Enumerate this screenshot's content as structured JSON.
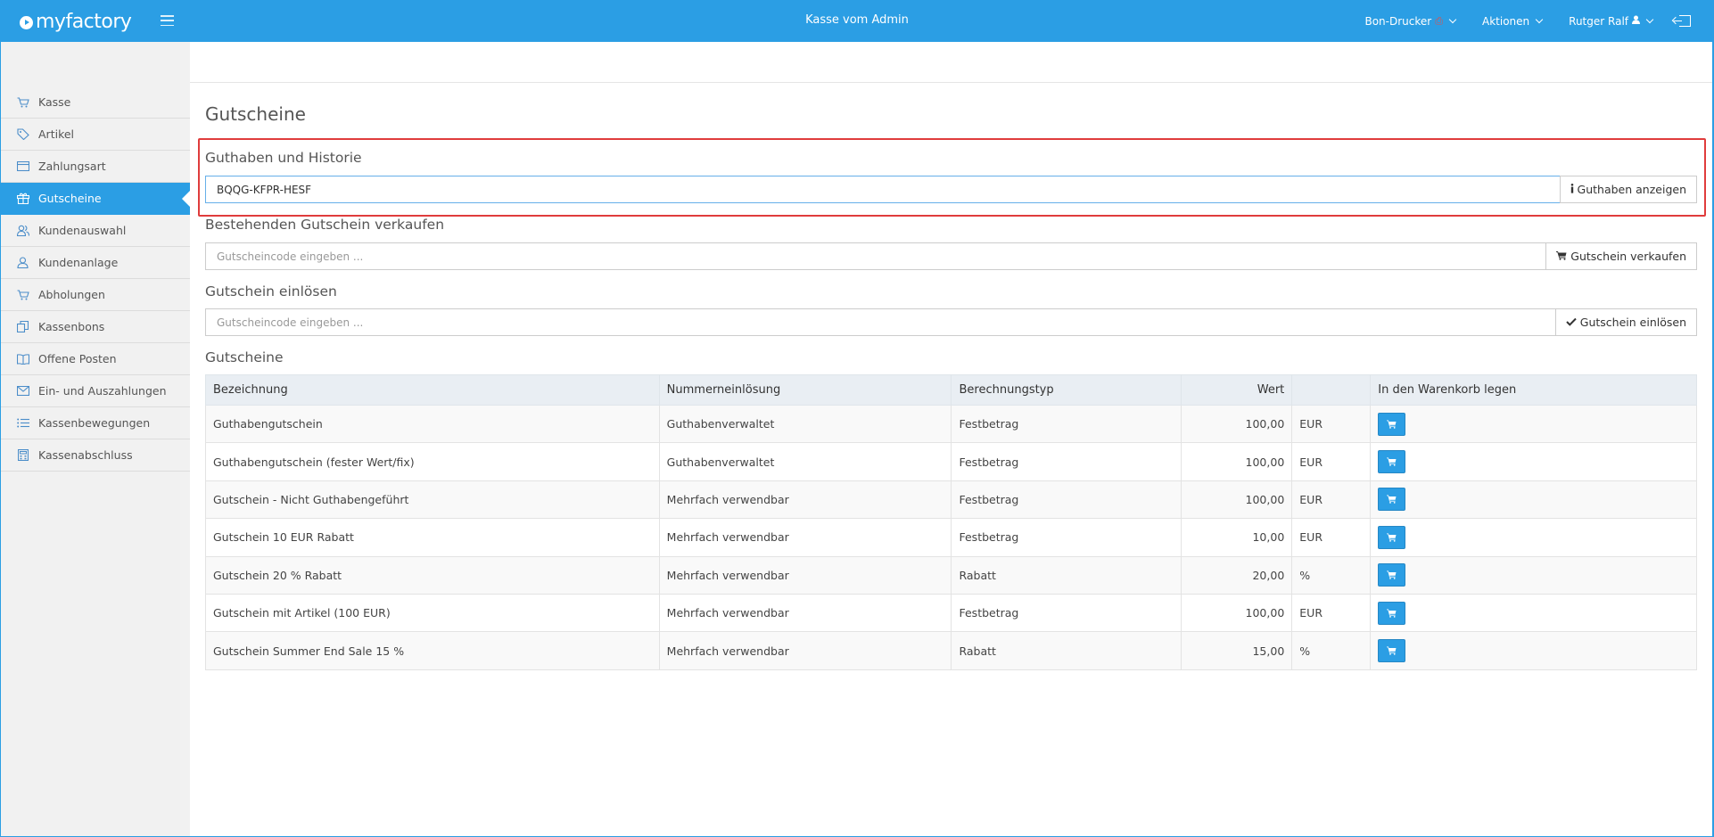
{
  "header": {
    "logo_text": "myfactory",
    "title": "Kasse vom Admin",
    "menus": [
      {
        "label": "Bon-Drucker"
      },
      {
        "label": "Aktionen"
      },
      {
        "label": "Rutger Ralf"
      }
    ]
  },
  "sidebar": {
    "items": [
      {
        "label": "Kasse",
        "icon": "cart-icon"
      },
      {
        "label": "Artikel",
        "icon": "tag-icon"
      },
      {
        "label": "Zahlungsart",
        "icon": "card-icon"
      },
      {
        "label": "Gutscheine",
        "icon": "gift-icon",
        "active": true
      },
      {
        "label": "Kundenauswahl",
        "icon": "users-icon"
      },
      {
        "label": "Kundenanlage",
        "icon": "user-icon"
      },
      {
        "label": "Abholungen",
        "icon": "cart-icon"
      },
      {
        "label": "Kassenbons",
        "icon": "copy-icon"
      },
      {
        "label": "Offene Posten",
        "icon": "book-icon"
      },
      {
        "label": "Ein- und Auszahlungen",
        "icon": "envelope-icon"
      },
      {
        "label": "Kassenbewegungen",
        "icon": "list-icon"
      },
      {
        "label": "Kassenabschluss",
        "icon": "calculator-icon"
      }
    ]
  },
  "main": {
    "page_title": "Gutscheine",
    "balance": {
      "title": "Guthaben und Historie",
      "input_value": "BQQG-KFPR-HESF",
      "button_label": "Guthaben anzeigen"
    },
    "sell": {
      "title": "Bestehenden Gutschein verkaufen",
      "placeholder": "Gutscheincode eingeben ...",
      "button_label": "Gutschein verkaufen"
    },
    "redeem": {
      "title": "Gutschein einlösen",
      "placeholder": "Gutscheincode eingeben ...",
      "button_label": "Gutschein einlösen"
    },
    "table": {
      "title": "Gutscheine",
      "columns": [
        "Bezeichnung",
        "Nummerneinlösung",
        "Berechnungstyp",
        "Wert",
        "",
        "In den Warenkorb legen"
      ],
      "rows": [
        {
          "name": "Guthabengutschein",
          "numbering": "Guthabenverwaltet",
          "calc": "Festbetrag",
          "value": "100,00",
          "unit": "EUR"
        },
        {
          "name": "Guthabengutschein (fester Wert/fix)",
          "numbering": "Guthabenverwaltet",
          "calc": "Festbetrag",
          "value": "100,00",
          "unit": "EUR"
        },
        {
          "name": "Gutschein - Nicht Guthabengeführt",
          "numbering": "Mehrfach verwendbar",
          "calc": "Festbetrag",
          "value": "100,00",
          "unit": "EUR"
        },
        {
          "name": "Gutschein 10 EUR Rabatt",
          "numbering": "Mehrfach verwendbar",
          "calc": "Festbetrag",
          "value": "10,00",
          "unit": "EUR"
        },
        {
          "name": "Gutschein 20 % Rabatt",
          "numbering": "Mehrfach verwendbar",
          "calc": "Rabatt",
          "value": "20,00",
          "unit": "%"
        },
        {
          "name": "Gutschein mit Artikel (100 EUR)",
          "numbering": "Mehrfach verwendbar",
          "calc": "Festbetrag",
          "value": "100,00",
          "unit": "EUR"
        },
        {
          "name": "Gutschein Summer End Sale 15 %",
          "numbering": "Mehrfach verwendbar",
          "calc": "Rabatt",
          "value": "15,00",
          "unit": "%"
        }
      ]
    }
  },
  "colors": {
    "primary": "#2b9ee4",
    "highlight_border": "#e03c3c"
  }
}
